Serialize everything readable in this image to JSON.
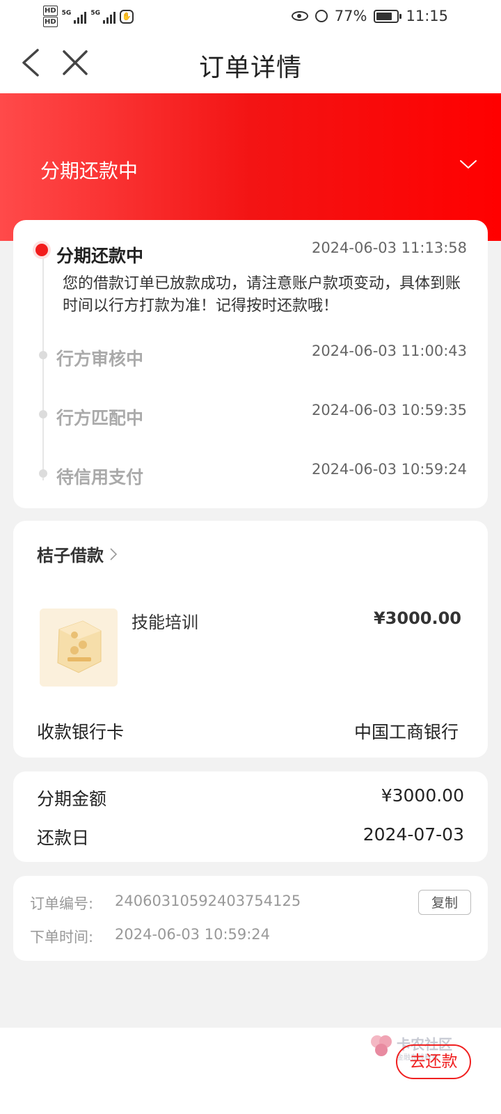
{
  "status_bar": {
    "hd1": "HD",
    "hd2": "HD",
    "sim1": "5G",
    "sim2": "5G",
    "battery_percent": "77%",
    "battery_level": 0.77,
    "time": "11:15"
  },
  "nav": {
    "title": "订单详情"
  },
  "header": {
    "status": "分期还款中"
  },
  "timeline": [
    {
      "name": "分期还款中",
      "time": "2024-06-03 11:13:58",
      "desc": "您的借款订单已放款成功，请注意账户款项变动，具体到账时间以行方打款为准！记得按时还款哦！",
      "active": true
    },
    {
      "name": "行方审核中",
      "time": "2024-06-03 11:00:43"
    },
    {
      "name": "行方匹配中",
      "time": "2024-06-03 10:59:35"
    },
    {
      "name": "待信用支付",
      "time": "2024-06-03 10:59:24"
    }
  ],
  "product": {
    "merchant": "桔子借款",
    "name": "技能培训",
    "price": "¥3000.00",
    "bank_label": "收款银行卡",
    "bank_value": "中国工商银行"
  },
  "amount": {
    "installment_label": "分期金额",
    "installment_value": "¥3000.00",
    "due_label": "还款日",
    "due_value": "2024-07-03"
  },
  "order": {
    "number_label": "订单编号:",
    "number_value": "24060310592403754125",
    "copy_label": "复制",
    "time_label": "下单时间:",
    "time_value": "2024-06-03 10:59:24"
  },
  "watermark": {
    "name": "卡农社区",
    "sub": "金融在线教育"
  },
  "bottom": {
    "repay_label": "去还款"
  },
  "colors": {
    "brand_red": "#f21c1c",
    "accent_text": "#f02020"
  }
}
